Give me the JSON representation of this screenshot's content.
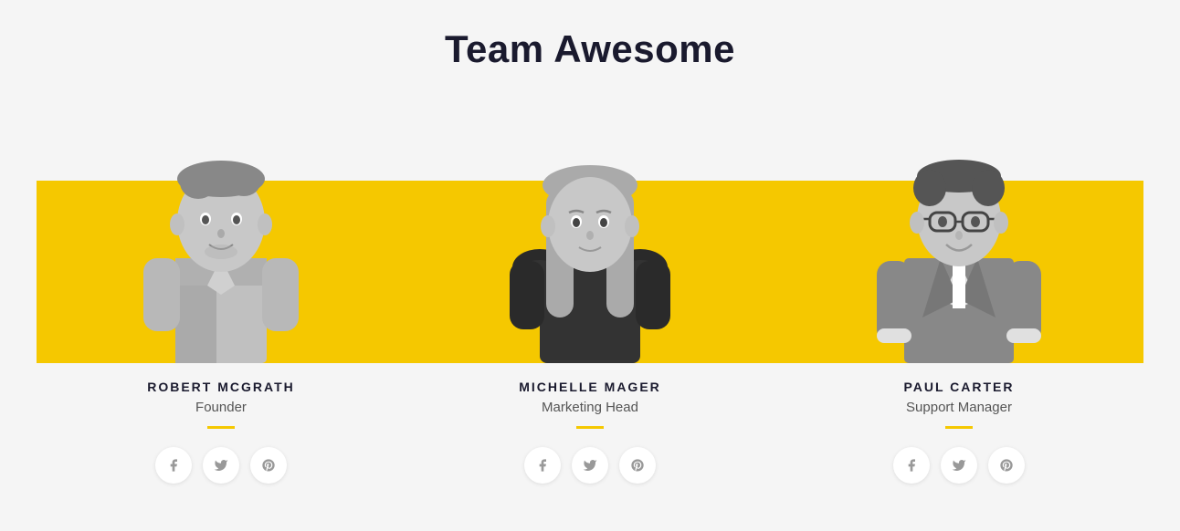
{
  "page": {
    "title": "Team Awesome",
    "background_color": "#f5f5f5",
    "accent_color": "#f5c800"
  },
  "team": {
    "members": [
      {
        "id": "robert",
        "name": "ROBERT MCGRATH",
        "role": "Founder",
        "social": {
          "facebook": "#",
          "twitter": "#",
          "pinterest": "#"
        }
      },
      {
        "id": "michelle",
        "name": "MICHELLE MAGER",
        "role": "Marketing Head",
        "social": {
          "facebook": "#",
          "twitter": "#",
          "pinterest": "#"
        }
      },
      {
        "id": "paul",
        "name": "PAUL CARTER",
        "role": "Support Manager",
        "social": {
          "facebook": "#",
          "twitter": "#",
          "pinterest": "#"
        }
      }
    ]
  },
  "icons": {
    "facebook": "f",
    "twitter": "t",
    "pinterest": "p"
  }
}
